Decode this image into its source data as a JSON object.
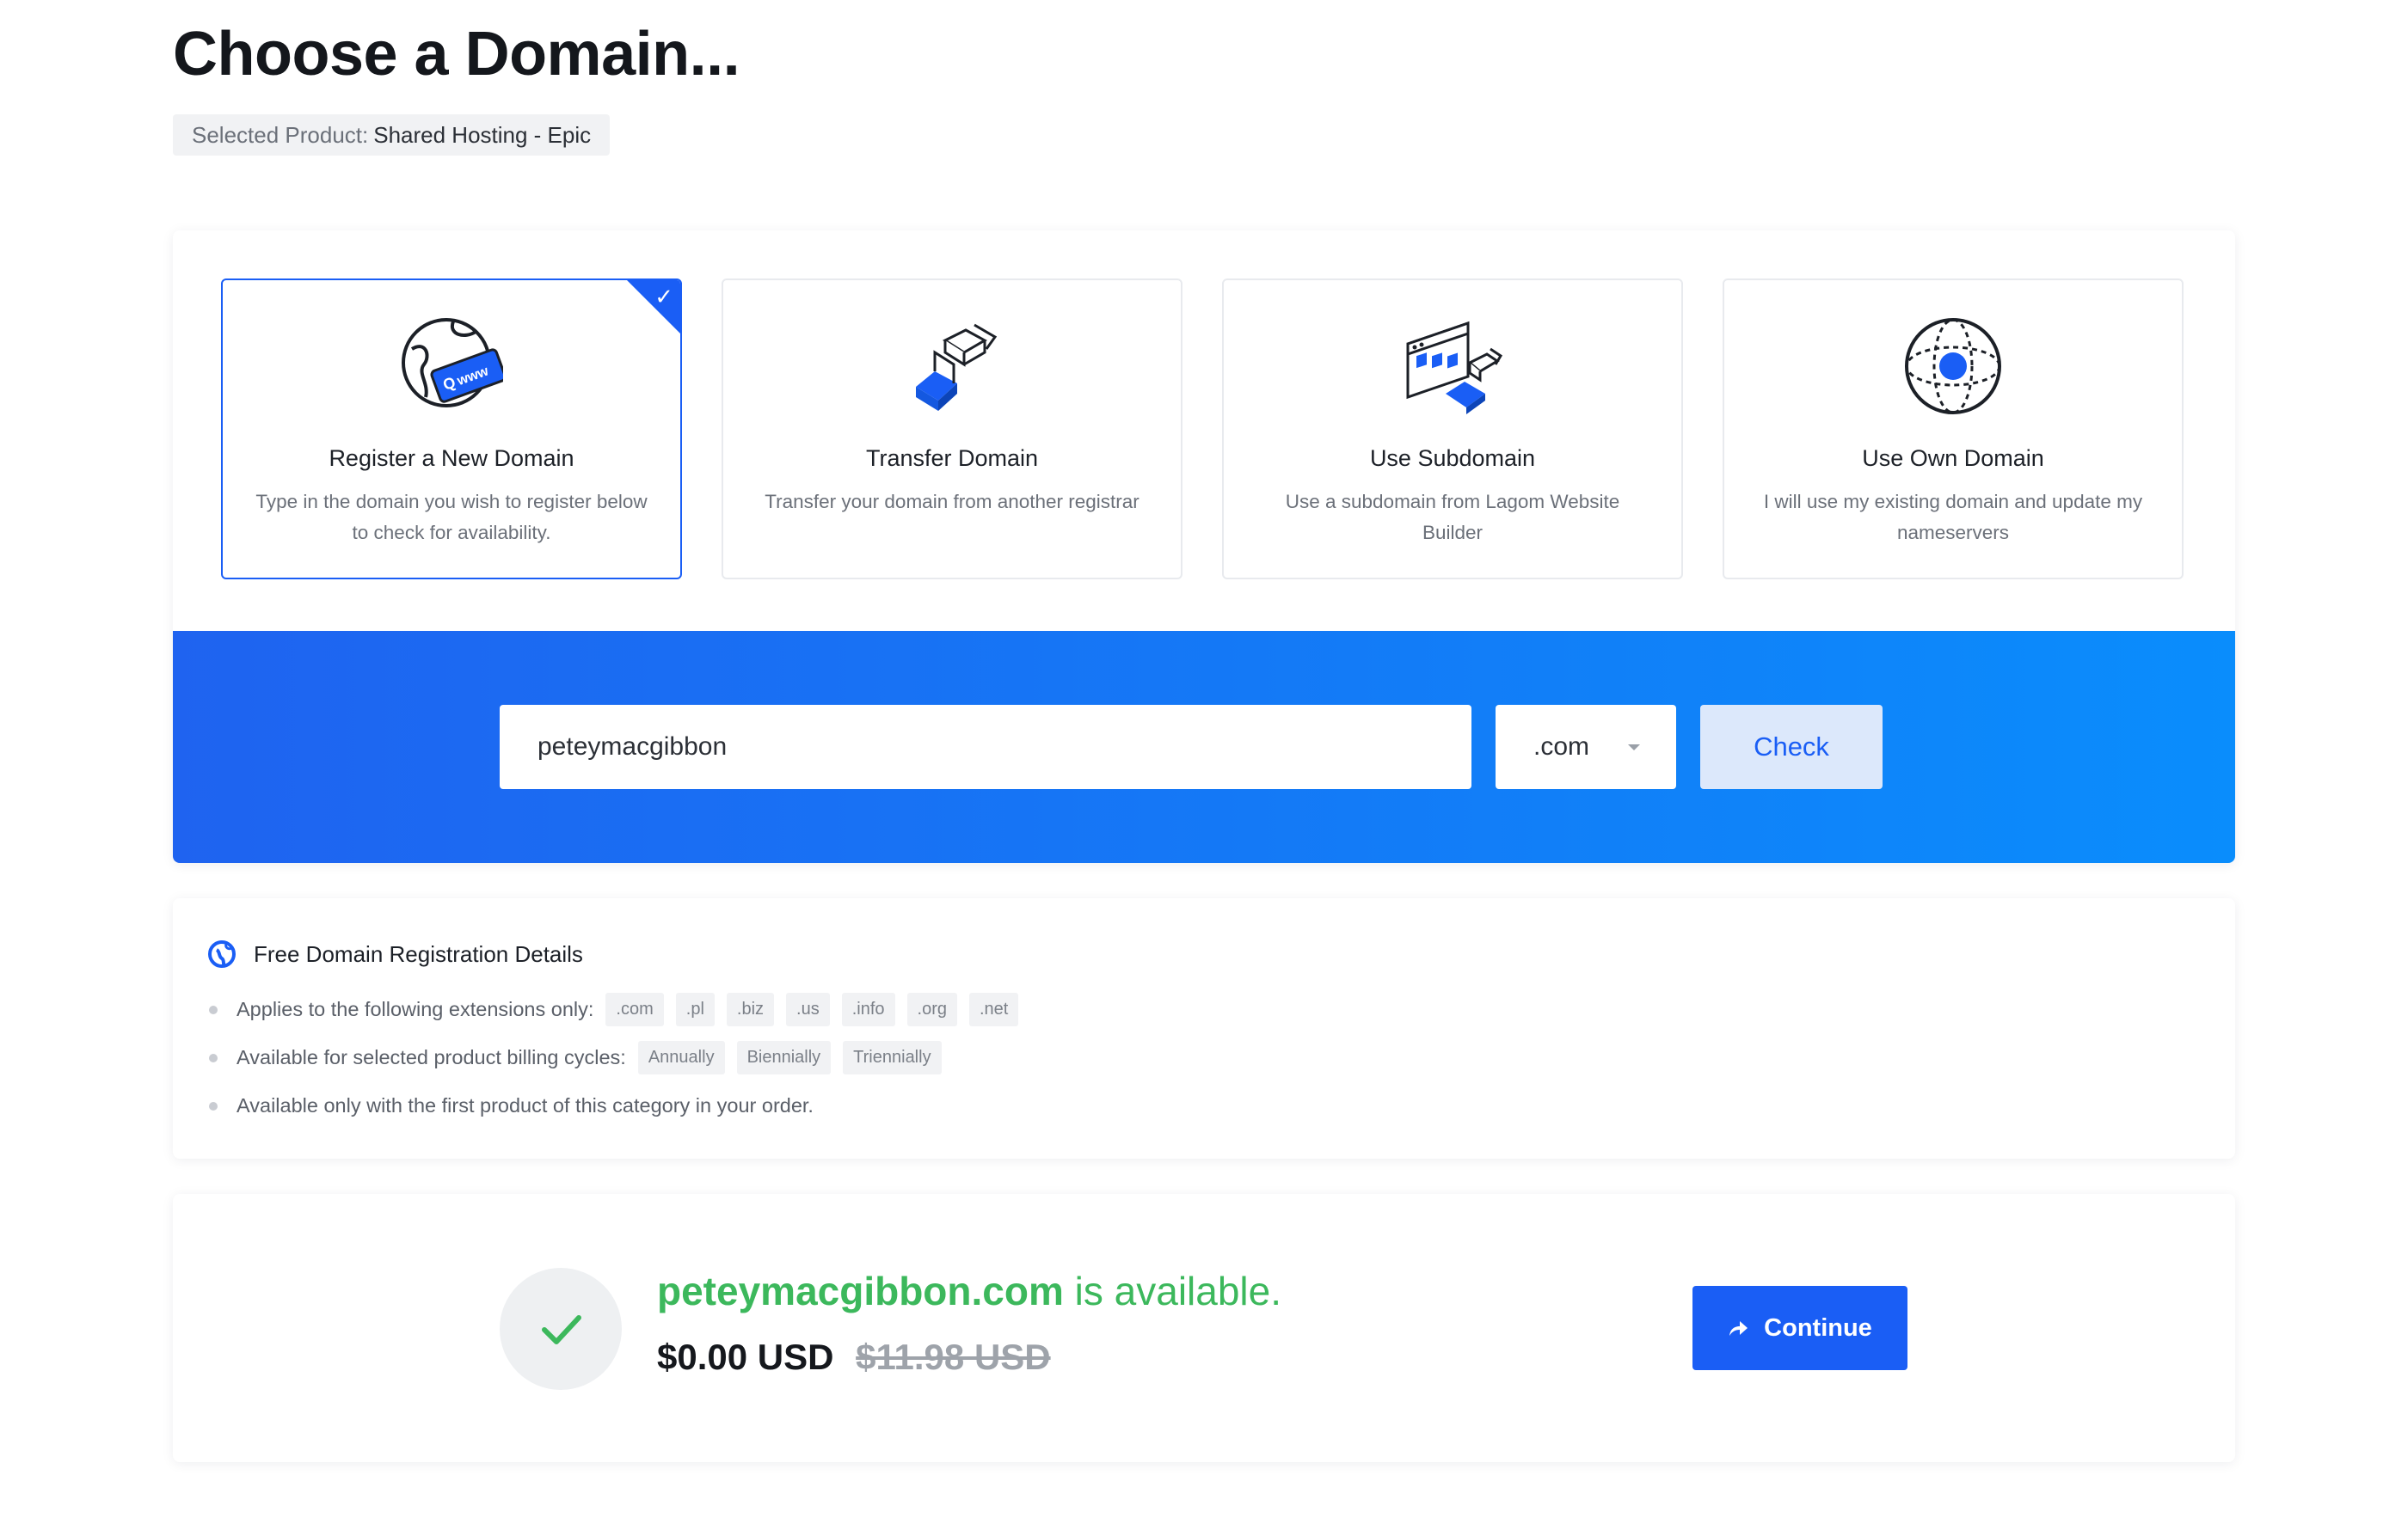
{
  "header": {
    "title": "Choose a Domain...",
    "product_label": "Selected Product:",
    "product_value": "Shared Hosting - Epic"
  },
  "options": [
    {
      "title": "Register a New Domain",
      "desc": "Type in the domain you wish to register below to check for availability.",
      "icon": "globe-www-icon",
      "selected": true
    },
    {
      "title": "Transfer Domain",
      "desc": "Transfer your domain from another registrar",
      "icon": "transfer-icon",
      "selected": false
    },
    {
      "title": "Use Subdomain",
      "desc": "Use a subdomain from Lagom Website Builder",
      "icon": "subdomain-browser-icon",
      "selected": false
    },
    {
      "title": "Use Own Domain",
      "desc": "I will use my existing domain and update my nameservers",
      "icon": "own-domain-globe-icon",
      "selected": false
    }
  ],
  "search": {
    "domain_value": "peteymacgibbon",
    "tld_value": ".com",
    "check_label": "Check"
  },
  "details": {
    "title": "Free Domain Registration Details",
    "extensions_label": "Applies to the following extensions only:",
    "extensions": [
      ".com",
      ".pl",
      ".biz",
      ".us",
      ".info",
      ".org",
      ".net"
    ],
    "cycles_label": "Available for selected product billing cycles:",
    "cycles": [
      "Annually",
      "Biennially",
      "Triennially"
    ],
    "first_product_note": "Available only with the first product of this category in your order."
  },
  "result": {
    "domain": "peteymacgibbon.com",
    "status_text": "is available.",
    "price": "$0.00 USD",
    "old_price": "$11.98 USD",
    "continue_label": "Continue"
  },
  "colors": {
    "primary": "#1a5ef5",
    "success": "#3cb85c",
    "band_start": "#1f63f0",
    "band_end": "#0a8dfc"
  }
}
